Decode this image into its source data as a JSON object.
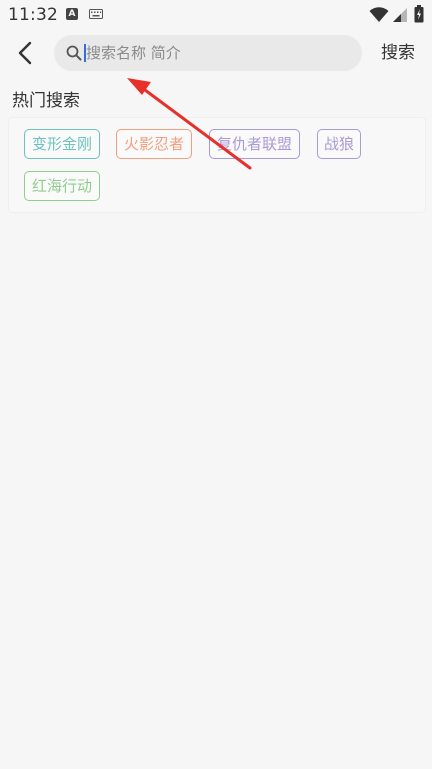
{
  "status_bar": {
    "time": "11:32",
    "notification_icon_letter": "A",
    "icons": [
      "a-notification-icon",
      "keyboard-icon",
      "wifi-icon",
      "signal-icon",
      "battery-icon"
    ]
  },
  "header": {
    "back_icon": "chevron-left-icon",
    "search": {
      "placeholder": "搜索名称 简介",
      "value": ""
    },
    "search_button_label": "搜索"
  },
  "hot_search": {
    "title": "热门搜索",
    "tags": [
      {
        "label": "变形金刚",
        "color": "#6cc3bd"
      },
      {
        "label": "火影忍者",
        "color": "#f29e7f"
      },
      {
        "label": "复仇者联盟",
        "color": "#a99ad8"
      },
      {
        "label": "战狼",
        "color": "#a99ad8"
      },
      {
        "label": "红海行动",
        "color": "#8fce8f"
      }
    ]
  },
  "colors": {
    "background": "#f6f6f6",
    "search_bg": "#e9e9e9",
    "cursor": "#2f6fe0",
    "annotation_arrow": "#e8302a"
  }
}
